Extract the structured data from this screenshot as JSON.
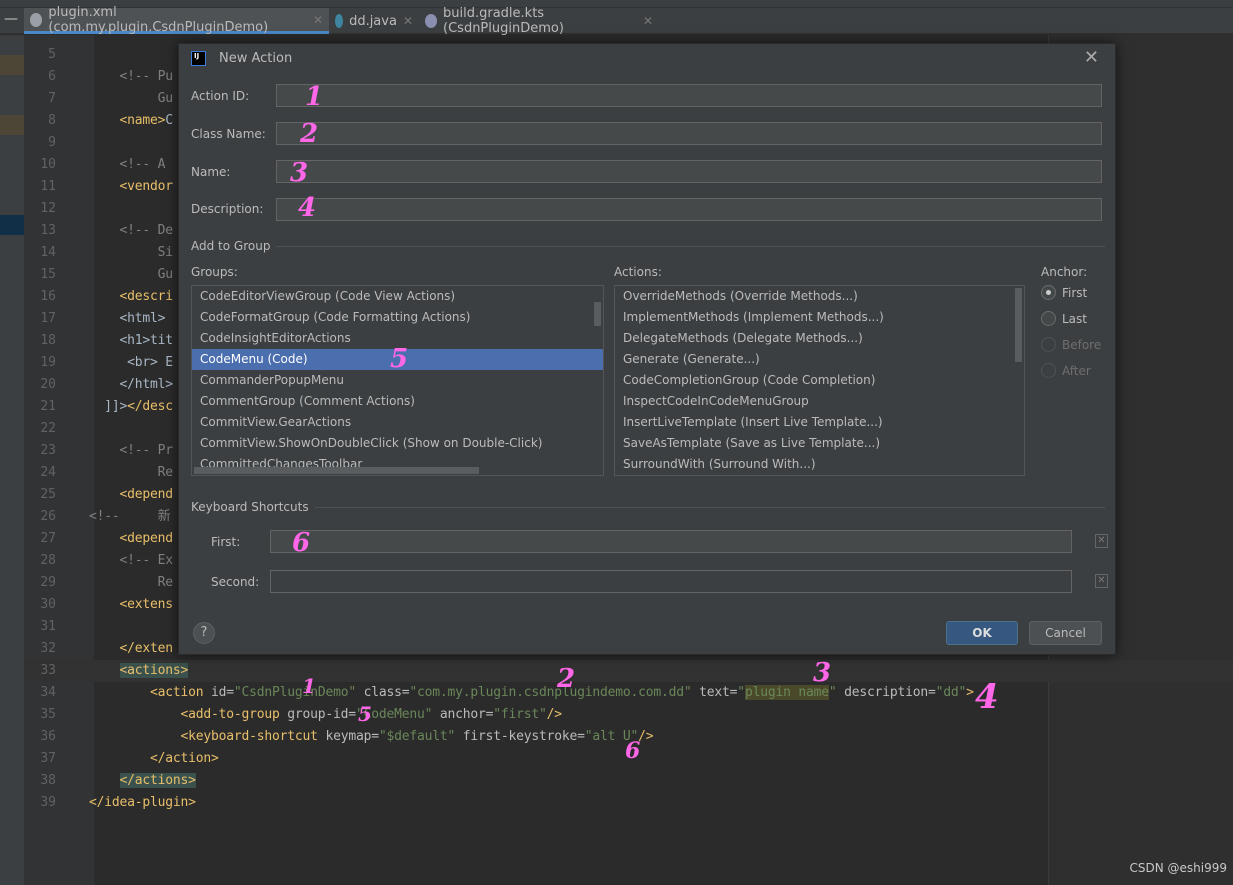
{
  "tabs": [
    {
      "label": "plugin.xml (com.my.plugin.CsdnPluginDemo)",
      "icon": "xml-file-icon",
      "color": "#9aa0a6",
      "active": true
    },
    {
      "label": "dd.java",
      "icon": "java-class-icon",
      "color": "#3e86a0",
      "active": false
    },
    {
      "label": "build.gradle.kts (CsdnPluginDemo)",
      "icon": "gradle-icon",
      "color": "#8a8fb0",
      "active": false
    }
  ],
  "code_lines": [
    {
      "n": "5",
      "s": []
    },
    {
      "n": "6",
      "s": [
        [
          "    <!-- Pu",
          "com"
        ]
      ]
    },
    {
      "n": "7",
      "s": [
        [
          "         Gu",
          "com"
        ]
      ]
    },
    {
      "n": "8",
      "s": [
        [
          "    <name>",
          "tag"
        ],
        [
          "C",
          ""
        ]
      ]
    },
    {
      "n": "9",
      "s": []
    },
    {
      "n": "10",
      "s": [
        [
          "    <!-- A",
          "com"
        ]
      ]
    },
    {
      "n": "11",
      "s": [
        [
          "    <vendor",
          "tag"
        ]
      ]
    },
    {
      "n": "12",
      "s": []
    },
    {
      "n": "13",
      "s": [
        [
          "    <!-- De",
          "com"
        ]
      ]
    },
    {
      "n": "14",
      "s": [
        [
          "         Si",
          "com"
        ]
      ]
    },
    {
      "n": "15",
      "s": [
        [
          "         Gu",
          "com"
        ]
      ]
    },
    {
      "n": "16",
      "s": [
        [
          "    <descri",
          "tag"
        ]
      ]
    },
    {
      "n": "17",
      "s": [
        [
          "    <html>",
          ""
        ]
      ]
    },
    {
      "n": "18",
      "s": [
        [
          "    <h1>tit",
          ""
        ]
      ]
    },
    {
      "n": "19",
      "s": [
        [
          "     <br> E",
          ""
        ]
      ]
    },
    {
      "n": "20",
      "s": [
        [
          "    </html>",
          ""
        ]
      ]
    },
    {
      "n": "21",
      "s": [
        [
          "  ]]>",
          ""
        ],
        [
          "</desc",
          "tag"
        ]
      ]
    },
    {
      "n": "22",
      "s": []
    },
    {
      "n": "23",
      "s": [
        [
          "    <!-- Pr",
          "com"
        ]
      ]
    },
    {
      "n": "24",
      "s": [
        [
          "         Re",
          "com"
        ]
      ]
    },
    {
      "n": "25",
      "s": [
        [
          "    <depend",
          "tag"
        ]
      ]
    },
    {
      "n": "26",
      "s": [
        [
          "<!--     新",
          "com"
        ]
      ]
    },
    {
      "n": "27",
      "s": [
        [
          "    <depend",
          "tag"
        ]
      ]
    },
    {
      "n": "28",
      "s": [
        [
          "    <!-- Ex",
          "com"
        ]
      ]
    },
    {
      "n": "29",
      "s": [
        [
          "         Re",
          "com"
        ]
      ]
    },
    {
      "n": "30",
      "s": [
        [
          "    <extens",
          "tag"
        ]
      ]
    },
    {
      "n": "31",
      "s": []
    },
    {
      "n": "32",
      "s": [
        [
          "    </exten",
          "tag"
        ]
      ]
    },
    {
      "n": "33",
      "s": [
        [
          "    ",
          ""
        ],
        [
          "<actions>",
          "tag hl"
        ]
      ],
      "current": true
    },
    {
      "n": "34",
      "s": [
        [
          "        <action ",
          "tag"
        ],
        [
          "id=",
          "attr"
        ],
        [
          "\"CsdnPluginDemo\"",
          "val"
        ],
        [
          " class=",
          "attr"
        ],
        [
          "\"com.my.plugin.csdnplugindemo.com.dd\"",
          "val"
        ],
        [
          " text=",
          "attr"
        ],
        [
          "\"",
          "val"
        ],
        [
          "plugin name",
          "val sel"
        ],
        [
          "\"",
          "val"
        ],
        [
          " description=",
          "attr"
        ],
        [
          "\"dd\"",
          "val"
        ],
        [
          ">",
          "tag"
        ]
      ]
    },
    {
      "n": "35",
      "s": [
        [
          "            <add-to-group ",
          "tag"
        ],
        [
          "group-id=",
          "attr"
        ],
        [
          "\"CodeMenu\"",
          "val"
        ],
        [
          " anchor=",
          "attr"
        ],
        [
          "\"first\"",
          "val"
        ],
        [
          "/>",
          "tag"
        ]
      ]
    },
    {
      "n": "36",
      "s": [
        [
          "            <keyboard-shortcut ",
          "tag"
        ],
        [
          "keymap=",
          "attr"
        ],
        [
          "\"$default\"",
          "val"
        ],
        [
          " first-keystroke=",
          "attr"
        ],
        [
          "\"alt U\"",
          "val"
        ],
        [
          "/>",
          "tag"
        ]
      ]
    },
    {
      "n": "37",
      "s": [
        [
          "        </action>",
          "tag"
        ]
      ]
    },
    {
      "n": "38",
      "s": [
        [
          "    ",
          ""
        ],
        [
          "</actions>",
          "tag hl"
        ]
      ]
    },
    {
      "n": "39",
      "s": [
        [
          "</idea-plugin>",
          "tag"
        ]
      ]
    }
  ],
  "dialog": {
    "title": "New Action",
    "fields": {
      "action_id": {
        "label": "Action ID:",
        "value": ""
      },
      "class_name": {
        "label": "Class Name:",
        "value": ""
      },
      "name": {
        "label": "Name:",
        "value": ""
      },
      "description": {
        "label": "Description:",
        "value": ""
      }
    },
    "add_to_group": "Add to Group",
    "groups_label": "Groups:",
    "groups": [
      "CodeEditorViewGroup (Code View Actions)",
      "CodeFormatGroup (Code Formatting Actions)",
      "CodeInsightEditorActions",
      "CodeMenu (Code)",
      "CommanderPopupMenu",
      "CommentGroup (Comment Actions)",
      "CommitView.GearActions",
      "CommitView.ShowOnDoubleClick (Show on Double-Click)",
      "CommittedChangesToolbar"
    ],
    "selected_group": "CodeMenu (Code)",
    "actions_label": "Actions:",
    "actions": [
      "OverrideMethods (Override Methods...)",
      "ImplementMethods (Implement Methods...)",
      "DelegateMethods (Delegate Methods...)",
      "Generate (Generate...)",
      "CodeCompletionGroup (Code Completion)",
      "InspectCodeInCodeMenuGroup",
      "InsertLiveTemplate (Insert Live Template...)",
      "SaveAsTemplate (Save as Live Template...)",
      "SurroundWith (Surround With...)"
    ],
    "anchor_label": "Anchor:",
    "anchors": [
      {
        "label": "First",
        "checked": true,
        "enabled": true
      },
      {
        "label": "Last",
        "checked": false,
        "enabled": true
      },
      {
        "label": "Before",
        "checked": false,
        "enabled": false
      },
      {
        "label": "After",
        "checked": false,
        "enabled": false
      }
    ],
    "keyboard_shortcuts": "Keyboard Shortcuts",
    "first_label": "First:",
    "first_value": "",
    "second_label": "Second:",
    "second_value": "",
    "help": "?",
    "ok": "OK",
    "cancel": "Cancel"
  },
  "annotations": [
    "1",
    "2",
    "3",
    "4",
    "5",
    "6"
  ],
  "watermark": "CSDN @eshi999",
  "colors": {
    "accent": "#4b6eaf",
    "annotation": "#ff66e8",
    "ok_button": "#365880"
  }
}
